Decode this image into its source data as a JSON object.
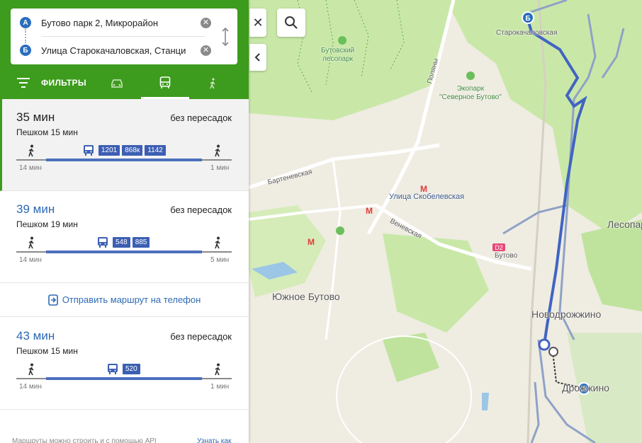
{
  "route_points": {
    "a": {
      "badge": "А",
      "value": "Бутово парк 2, Микрорайон"
    },
    "b": {
      "badge": "Б",
      "value": "Улица Старокачаловская, Станци"
    }
  },
  "filters_label": "ФИЛЬТРЫ",
  "modes": {
    "active": "transit",
    "icons": [
      "car-icon",
      "bus-icon",
      "walk-icon"
    ]
  },
  "routes": [
    {
      "time": "35 мин",
      "transfers": "без пересадок",
      "walk": "Пешком 15 мин",
      "buses": [
        "1201",
        "868к",
        "1142"
      ],
      "walk_before": "14 мин",
      "walk_after": "1 мин",
      "selected": true
    },
    {
      "time": "39 мин",
      "transfers": "без пересадок",
      "walk": "Пешком 19 мин",
      "buses": [
        "548",
        "885"
      ],
      "walk_before": "14 мин",
      "walk_after": "5 мин",
      "selected": false
    },
    {
      "time": "43 мин",
      "transfers": "без пересадок",
      "walk": "Пешком 15 мин",
      "buses": [
        "520"
      ],
      "walk_before": "14 мин",
      "walk_after": "1 мин",
      "selected": false
    }
  ],
  "send_to_phone": "Отправить маршрут на телефон",
  "footer": {
    "note": "Маршруты можно строить и с помощью API",
    "link": "Узнать как"
  },
  "map": {
    "labels": {
      "forest": "Бутовский\nлесопарк",
      "ecopark": "Экопарк\n\"Северное Бутово\"",
      "starokach": "Старокачаловская",
      "polyany": "Поляны",
      "bartenevskaya": "Бартеневская",
      "skobelevskaya": "Улица Скобелевская",
      "venevskaya": "Веневская",
      "yuzhnoe_butovo": "Южное Бутово",
      "lesopark": "Лесопарк",
      "butovo": "Бутово",
      "d2": "D2",
      "novodrozhzhino": "Новодрожжино",
      "drozhzhino": "Дрожжино"
    },
    "colors": {
      "route": "#4164c2",
      "alt_route": "#8fa2c6",
      "forest": "#c7e6a7",
      "water": "#9cc6e6",
      "metro": "#e23b3b"
    }
  }
}
